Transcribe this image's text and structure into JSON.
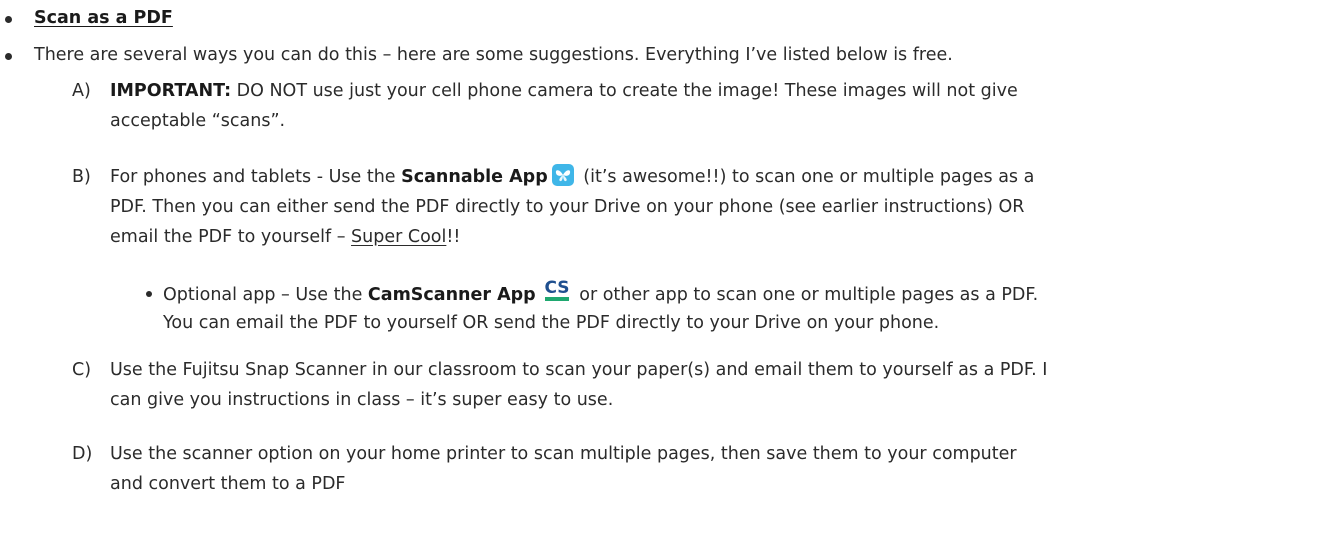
{
  "bullets": {
    "heading": "Scan as a PDF",
    "intro": "There are several ways you can do this – here are some suggestions. Everything I’ve listed below is free."
  },
  "items": {
    "a": {
      "letter": "A)",
      "bold": "IMPORTANT:",
      "line1": " DO NOT use just your cell phone camera to create the image! These images will not give",
      "line2": "acceptable “scans”."
    },
    "b": {
      "letter": "B)",
      "pre": "For phones and tablets - Use the ",
      "bold": "Scannable App",
      "post": " (it’s awesome!!) to scan one or multiple pages as a",
      "line2": "PDF. Then you can either send the PDF directly to your Drive on your phone (see earlier instructions) OR",
      "line3_pre": "email the  PDF to yourself – ",
      "line3_link": "Super Cool",
      "line3_post": "!!"
    },
    "b_sub": {
      "pre": "Optional app – Use the ",
      "bold": "CamScanner App",
      "icon_text": "CS",
      "post": " or other app to scan one or multiple pages as a PDF.",
      "line2": "You can email the PDF to yourself OR send the PDF directly to your Drive on your phone."
    },
    "c": {
      "letter": "C)",
      "line1": "Use the Fujitsu Snap Scanner in our classroom to scan your paper(s) and email them to yourself as a PDF. I",
      "line2": "can give you instructions in class – it’s super easy to use."
    },
    "d": {
      "letter": "D)",
      "line1": "Use the scanner option on your home printer to scan multiple pages, then save them to your computer",
      "line2": "and convert them to a PDF"
    }
  },
  "icons": {
    "scannable": {
      "name": "scannable-app-icon",
      "color": "#3fb6e8"
    },
    "camscanner": {
      "name": "camscanner-app-icon",
      "color": "#1fa870",
      "text_color": "#1f4f8f"
    }
  }
}
